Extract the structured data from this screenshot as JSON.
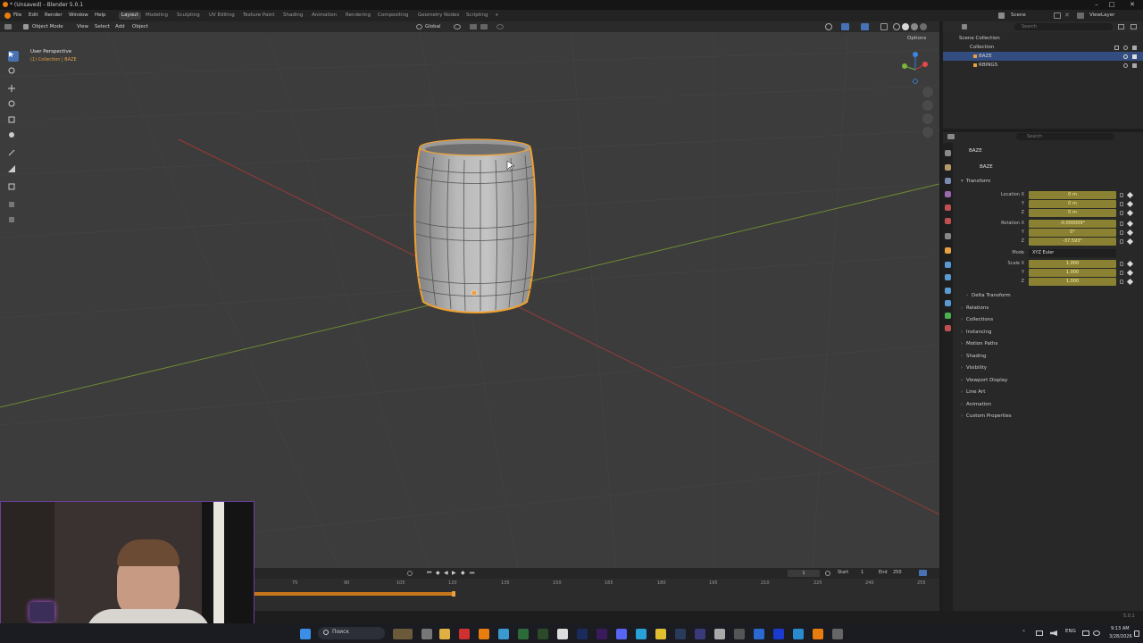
{
  "window": {
    "title": "* (Unsaved) - Blender 5.0.1",
    "controls": [
      "–",
      "□",
      "✕"
    ]
  },
  "menubar": {
    "items": [
      "File",
      "Edit",
      "Render",
      "Window",
      "Help"
    ],
    "workspaces": [
      "Layout",
      "Modeling",
      "Sculpting",
      "UV Editing",
      "Texture Paint",
      "Shading",
      "Animation",
      "Rendering",
      "Compositing",
      "Geometry Nodes",
      "Scripting"
    ],
    "active_workspace": "Layout",
    "add_tab": "+",
    "scene": "Scene",
    "view_layer": "ViewLayer"
  },
  "viewport_header": {
    "mode": "Object Mode",
    "menus": [
      "View",
      "Select",
      "Add",
      "Object"
    ],
    "transform_orientation": "Global",
    "options": "Options"
  },
  "viewport": {
    "view_name": "User Perspective",
    "context": "(1) Collection | BAZE",
    "axis_labels": [
      "X",
      "Y",
      "Z"
    ]
  },
  "outliner": {
    "search_placeholder": "Search",
    "rows": [
      {
        "label": "Scene Collection"
      },
      {
        "label": "Collection"
      },
      {
        "label": "BAZE",
        "selected": true
      },
      {
        "label": "RBINGS"
      }
    ]
  },
  "properties": {
    "search_placeholder": "Search",
    "object_name": "BAZE",
    "data_name": "BAZE",
    "transform_title": "Transform",
    "location_label": "Location X",
    "location": [
      "0 m",
      "0 m",
      "0 m"
    ],
    "rotation_label": "Rotation X",
    "rotation": [
      "-0.000009°",
      "0°",
      "-37.593°"
    ],
    "mode_label": "Mode",
    "mode": "XYZ Euler",
    "scale_label": "Scale X",
    "scale": [
      "1.000",
      "1.000",
      "1.000"
    ],
    "axis_y": "Y",
    "axis_z": "Z",
    "delta_transform": "Delta Transform",
    "panels": [
      "Relations",
      "Collections",
      "Instancing",
      "Motion Paths",
      "Shading",
      "Visibility",
      "Viewport Display",
      "Line Art",
      "Animation",
      "Custom Properties"
    ]
  },
  "timeline": {
    "current_frame": "1",
    "start_label": "Start",
    "start": "1",
    "end_label": "End",
    "end": "250",
    "ticks": [
      "75",
      "90",
      "105",
      "120",
      "135",
      "150",
      "165",
      "180",
      "195",
      "210",
      "225",
      "240",
      "255"
    ]
  },
  "statusbar": {
    "version": "5.0.1"
  },
  "taskbar": {
    "search_placeholder": "Поиск",
    "lang": "ENG",
    "time": "9:13 AM",
    "date": "3/28/2026"
  },
  "colors": {
    "accent": "#4772b3",
    "selection_outline": "#f0a030",
    "field_animated": "#8a8132"
  }
}
